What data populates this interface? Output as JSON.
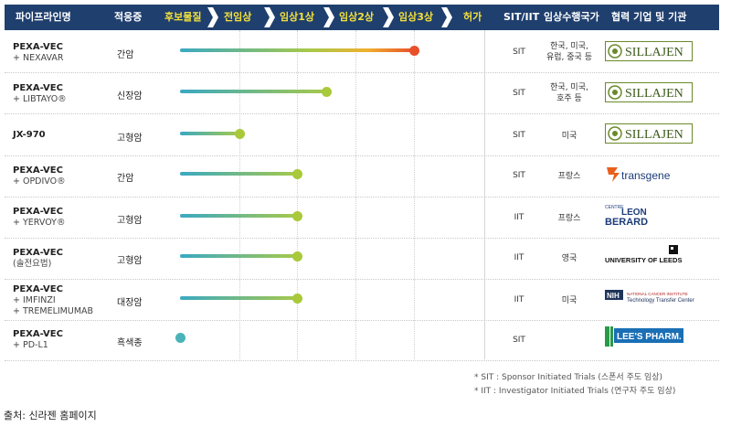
{
  "header": {
    "pipeline": "파이프라인명",
    "indication": "적응증",
    "stages": [
      "후보물질",
      "전임상",
      "임상1상",
      "임상2상",
      "임상3상",
      "허가"
    ],
    "sit_iit": "SIT/IIT",
    "countries": "임상수행국가",
    "partners": "협력 기업 및 기관"
  },
  "rows": [
    {
      "name": "PEXA-VEC",
      "sub": "+ NEXAVAR",
      "indication": "간암",
      "progress_stage": 4.0,
      "sit": "SIT",
      "country": "한국, 미국,\n유럽, 중국 등",
      "partner": "SILLAJEN"
    },
    {
      "name": "PEXA-VEC",
      "sub": "+ LIBTAYO®",
      "indication": "신장암",
      "progress_stage": 2.5,
      "sit": "SIT",
      "country": "한국, 미국,\n호주 등",
      "partner": "SILLAJEN"
    },
    {
      "name": "JX-970",
      "sub": "",
      "indication": "고형암",
      "progress_stage": 1.0,
      "sit": "SIT",
      "country": "미국",
      "partner": "SILLAJEN"
    },
    {
      "name": "PEXA-VEC",
      "sub": "+ OPDIVO®",
      "indication": "간암",
      "progress_stage": 2.0,
      "sit": "SIT",
      "country": "프랑스",
      "partner": "transgene"
    },
    {
      "name": "PEXA-VEC",
      "sub": "+ YERVOY®",
      "indication": "고형암",
      "progress_stage": 2.0,
      "sit": "IIT",
      "country": "프랑스",
      "partner": "LEON BERARD"
    },
    {
      "name": "PEXA-VEC",
      "sub": "(솔전요법)",
      "indication": "고형암",
      "progress_stage": 2.0,
      "sit": "IIT",
      "country": "영국",
      "partner": "UNIVERSITY OF LEEDS"
    },
    {
      "name": "PEXA-VEC",
      "sub": "+ IMFINZI\n+ TREMELIMUMAB",
      "indication": "대장암",
      "progress_stage": 2.0,
      "sit": "IIT",
      "country": "미국",
      "partner": "NIH"
    },
    {
      "name": "PEXA-VEC",
      "sub": "+ PD-L1",
      "indication": "흑색종",
      "progress_stage": 0.0,
      "sit": "SIT",
      "country": "",
      "partner": "LEE'S PHARM."
    }
  ],
  "logos": {
    "sillajen": "SILLAJEN",
    "transgene": "transgene",
    "leon_top": "CENTRE",
    "leon_1": "LEON",
    "leon_2": "BERARD",
    "leeds": "UNIVERSITY OF LEEDS",
    "nih_badge": "NIH",
    "nih_1": "NATIONAL CANCER INSTITUTE",
    "nih_2": "Technology Transfer Center",
    "lees": "LEE'S PHARM."
  },
  "footnotes": {
    "sit": "* SIT : Sponsor Initiated Trials (스폰서 주도 임상)",
    "iit": "* IIT : Investigator Initiated Trials (연구자 주도 임상)"
  },
  "source": "출처: 신라젠 홈페이지",
  "colors": {
    "header_bg": "#1f3f6e",
    "stage_text": "#f5e23a",
    "bar_start": "#3aa9c2",
    "bar_mid": "#a6c94a",
    "bar_end": "#e8502a",
    "dot_green": "#a9c93a",
    "dot_teal": "#49b3b8"
  }
}
